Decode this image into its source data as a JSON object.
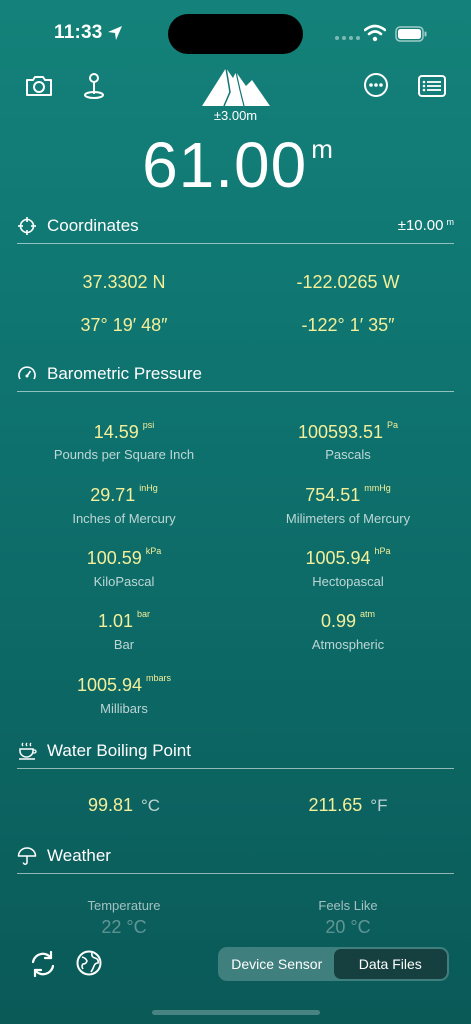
{
  "status": {
    "time": "11:33"
  },
  "header": {
    "accuracy": "±3.00m"
  },
  "altitude": {
    "value": "61.00",
    "unit": "m"
  },
  "coordinates": {
    "title": "Coordinates",
    "accuracy": "±10.00",
    "accuracy_unit": "m",
    "lat_decimal": "37.3302 N",
    "lon_decimal": "-122.0265 W",
    "lat_dms": "37° 19′ 48″",
    "lon_dms": "-122° 1′ 35″"
  },
  "pressure": {
    "title": "Barometric Pressure",
    "items": [
      {
        "value": "14.59",
        "unit": "psi",
        "label": "Pounds per Square Inch"
      },
      {
        "value": "100593.51",
        "unit": "Pa",
        "label": "Pascals"
      },
      {
        "value": "29.71",
        "unit": "inHg",
        "label": "Inches of Mercury"
      },
      {
        "value": "754.51",
        "unit": "mmHg",
        "label": "Milimeters of Mercury"
      },
      {
        "value": "100.59",
        "unit": "kPa",
        "label": "KiloPascal"
      },
      {
        "value": "1005.94",
        "unit": "hPa",
        "label": "Hectopascal"
      },
      {
        "value": "1.01",
        "unit": "bar",
        "label": "Bar"
      },
      {
        "value": "0.99",
        "unit": "atm",
        "label": "Atmospheric"
      },
      {
        "value": "1005.94",
        "unit": "mbars",
        "label": "Millibars"
      }
    ]
  },
  "boiling": {
    "title": "Water Boiling Point",
    "celsius": "99.81",
    "celsius_unit": "°C",
    "fahrenheit": "211.65",
    "fahrenheit_unit": "°F"
  },
  "weather": {
    "title": "Weather",
    "temp_label": "Temperature",
    "temp_value": "22 °C",
    "feels_label": "Feels Like",
    "feels_value": "20 °C"
  },
  "bottom": {
    "seg_device": "Device Sensor",
    "seg_files": "Data Files"
  }
}
